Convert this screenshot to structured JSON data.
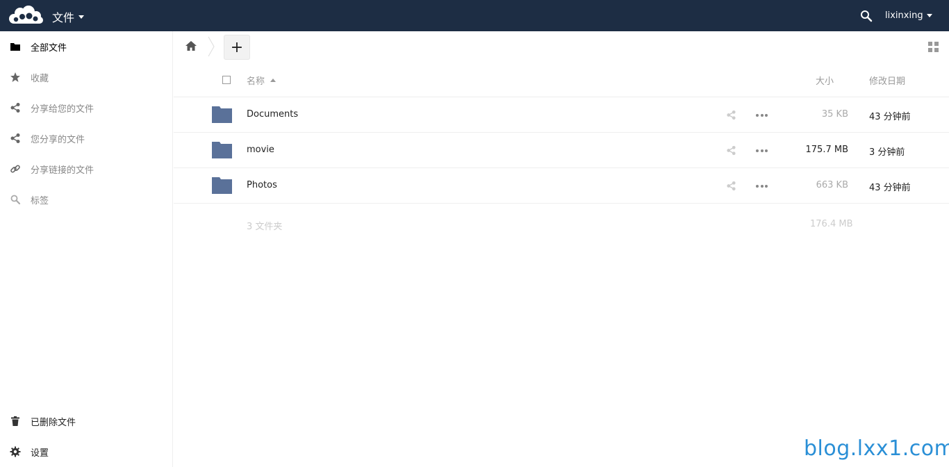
{
  "header": {
    "app_title": "文件",
    "username": "lixinxing"
  },
  "sidebar": {
    "items": [
      {
        "label": "全部文件",
        "icon": "folder-icon"
      },
      {
        "label": "收藏",
        "icon": "star-icon"
      },
      {
        "label": "分享给您的文件",
        "icon": "share-icon"
      },
      {
        "label": "您分享的文件",
        "icon": "share-icon"
      },
      {
        "label": "分享链接的文件",
        "icon": "link-icon"
      },
      {
        "label": "标签",
        "icon": "search-icon"
      }
    ],
    "bottom": [
      {
        "label": "已删除文件",
        "icon": "trash-icon"
      },
      {
        "label": "设置",
        "icon": "gear-icon"
      }
    ]
  },
  "controls": {
    "new_label": "+"
  },
  "table": {
    "headers": {
      "name": "名称",
      "size": "大小",
      "modified": "修改日期"
    },
    "rows": [
      {
        "name": "Documents",
        "size": "35 KB",
        "modified": "43 分钟前",
        "size_color": "#aaaaaa"
      },
      {
        "name": "movie",
        "size": "175.7 MB",
        "modified": "3 分钟前",
        "size_color": "#222222"
      },
      {
        "name": "Photos",
        "size": "663 KB",
        "modified": "43 分钟前",
        "size_color": "#aaaaaa"
      }
    ],
    "summary": {
      "count": "3 文件夹",
      "size": "176.4 MB"
    }
  },
  "colors": {
    "header_bg": "#1d2d44",
    "folder": "#5a7199",
    "watermark": "#2a8fd6"
  },
  "watermark": "blog.lxx1.com"
}
